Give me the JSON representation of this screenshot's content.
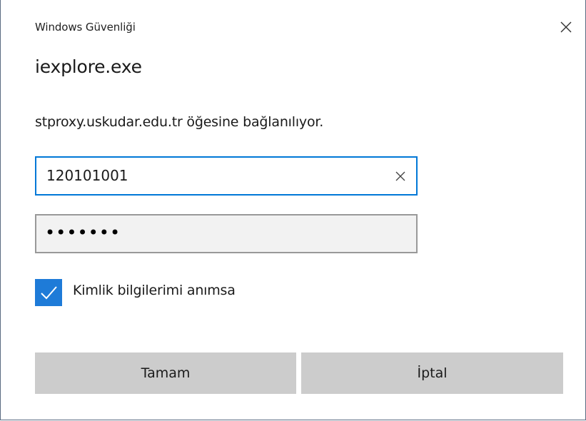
{
  "dialog": {
    "title": "Windows Güvenliği",
    "app_name": "iexplore.exe",
    "message": "stproxy.uskudar.edu.tr öğesine bağlanılıyor."
  },
  "username": {
    "value": "120101001"
  },
  "password": {
    "masked_value": "•••••••"
  },
  "remember": {
    "label": "Kimlik bilgilerimi anımsa",
    "checked": true
  },
  "buttons": {
    "ok_label": "Tamam",
    "cancel_label": "İptal"
  },
  "colors": {
    "accent": "#0078d7",
    "checkbox": "#1e7bd8",
    "button_bg": "#cccccc"
  },
  "icons": {
    "close": "close-icon",
    "clear": "clear-icon",
    "check": "checkmark-icon"
  }
}
